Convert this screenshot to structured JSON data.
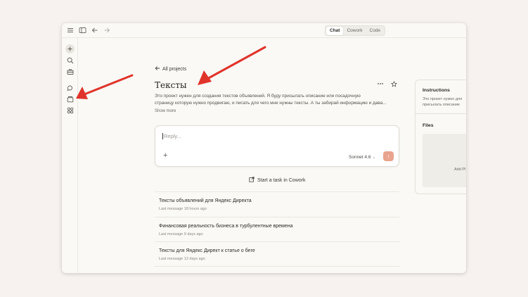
{
  "topbar": {
    "tabs": [
      {
        "label": "Chat",
        "active": true
      },
      {
        "label": "Cowork",
        "active": false
      },
      {
        "label": "Code",
        "active": false
      }
    ]
  },
  "project": {
    "back_label": "All projects",
    "title": "Тексты",
    "description_line1": "Это проект нужен для создания текстов объявлений. Я буду присылать описание или посадочную",
    "description_line2": "страницу которую нужно продвигаю, и писать для чего мне нужны тексты. А ты забирай информацию и дава...",
    "show_more": "Show more"
  },
  "composer": {
    "placeholder": "Reply...",
    "model_label": "Sonnet 4.6"
  },
  "cowork_link": "Start a task in Cowork",
  "conversations": [
    {
      "title": "Тексты объявлений для Яндекс Директа",
      "meta": "Last message 18 hours ago"
    },
    {
      "title": "Финансовая реальность бизнеса в турбулентные времена",
      "meta": "Last message 9 days ago"
    },
    {
      "title": "Тексты для Яндекс Директ к статье о беге",
      "meta": "Last message 12 days ago"
    }
  ],
  "right_panel": {
    "instructions_title": "Instructions",
    "instructions_line1": "Это проект нужен для",
    "instructions_line2": "присылать описание",
    "files_title": "Files",
    "add_label": "Add Pl"
  },
  "colors": {
    "accent_send": "#e8a48d",
    "annotation_arrow": "#e0342b",
    "background": "#f7f1ef"
  },
  "icons": [
    "menu-icon",
    "sidebar-toggle-icon",
    "back-arrow-icon",
    "forward-arrow-icon",
    "new-chat-icon",
    "search-icon",
    "briefcase-icon",
    "chats-icon",
    "projects-icon",
    "artifacts-icon",
    "more-icon",
    "star-icon",
    "plus-icon",
    "send-icon",
    "external-task-icon"
  ]
}
